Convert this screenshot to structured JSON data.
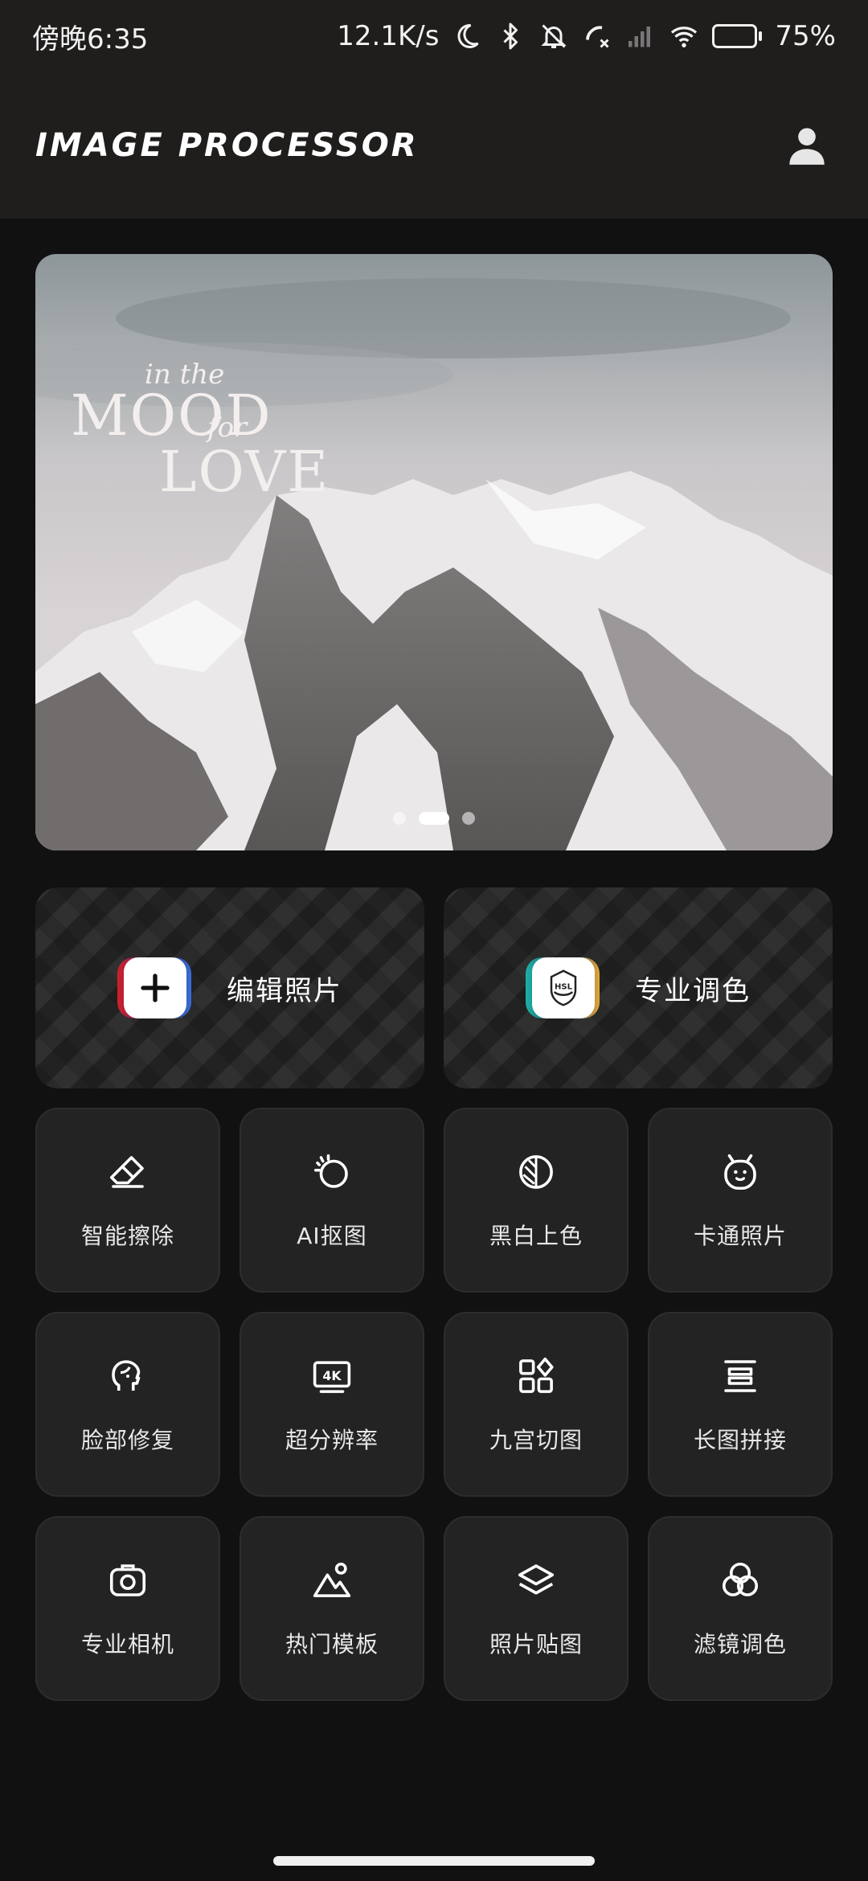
{
  "status_bar": {
    "time": "傍晚6:35",
    "network_speed": "12.1K/s",
    "battery_percent": "75%",
    "battery_level": 0.75,
    "icons": [
      "moon-icon",
      "bluetooth-icon",
      "mute-icon",
      "missed-call-icon",
      "signal-icon",
      "wifi-icon",
      "battery-icon"
    ]
  },
  "app_bar": {
    "title": "IMAGE PROCESSOR",
    "profile_icon": "user-icon"
  },
  "banner": {
    "title_small": "in the",
    "title_mood": "MOOD",
    "title_for": "for",
    "title_love": "LOVE",
    "dots": 3,
    "active_dot": 1
  },
  "primary_actions": [
    {
      "label": "编辑照片",
      "icon": "plus-icon"
    },
    {
      "label": "专业调色",
      "icon": "hsl-icon"
    }
  ],
  "tools": [
    {
      "label": "智能擦除",
      "icon": "eraser-icon"
    },
    {
      "label": "AI抠图",
      "icon": "cutout-icon"
    },
    {
      "label": "黑白上色",
      "icon": "colorize-icon"
    },
    {
      "label": "卡通照片",
      "icon": "cartoon-icon"
    },
    {
      "label": "脸部修复",
      "icon": "face-icon"
    },
    {
      "label": "超分辨率",
      "icon": "4k-icon"
    },
    {
      "label": "九宫切图",
      "icon": "grid-icon"
    },
    {
      "label": "长图拼接",
      "icon": "stitch-icon"
    },
    {
      "label": "专业相机",
      "icon": "camera-icon"
    },
    {
      "label": "热门模板",
      "icon": "template-icon"
    },
    {
      "label": "照片贴图",
      "icon": "layers-icon"
    },
    {
      "label": "滤镜调色",
      "icon": "filter-icon"
    }
  ],
  "colors": {
    "background": "#111111",
    "header": "#201e1d",
    "tile": "#232323",
    "battery_green": "#4cd964"
  }
}
